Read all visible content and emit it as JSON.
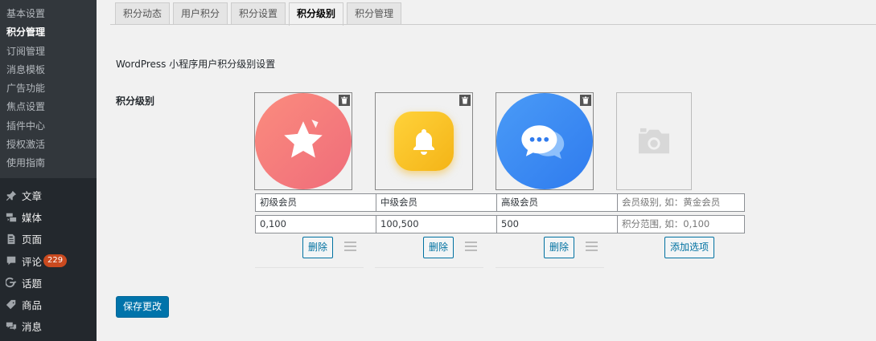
{
  "sidebar": {
    "submenu": [
      {
        "label": "基本设置"
      },
      {
        "label": "积分管理",
        "active": true
      },
      {
        "label": "订阅管理"
      },
      {
        "label": "消息模板"
      },
      {
        "label": "广告功能"
      },
      {
        "label": "焦点设置"
      },
      {
        "label": "插件中心"
      },
      {
        "label": "授权激活"
      },
      {
        "label": "使用指南"
      }
    ],
    "menu": [
      {
        "label": "文章",
        "icon": "pin-icon"
      },
      {
        "label": "媒体",
        "icon": "media-icon"
      },
      {
        "label": "页面",
        "icon": "page-icon"
      },
      {
        "label": "评论",
        "icon": "comment-icon",
        "badge": "229"
      },
      {
        "label": "话题",
        "icon": "topic-icon"
      },
      {
        "label": "商品",
        "icon": "tag-icon"
      },
      {
        "label": "消息",
        "icon": "message-icon"
      }
    ]
  },
  "tabs": [
    {
      "label": "积分动态"
    },
    {
      "label": "用户积分"
    },
    {
      "label": "积分设置"
    },
    {
      "label": "积分级别",
      "active": true
    },
    {
      "label": "积分管理"
    }
  ],
  "page": {
    "heading": "WordPress 小程序用户积分级别设置",
    "field_label": "积分级别"
  },
  "levels": [
    {
      "name": "初级会员",
      "range": "0,100",
      "delete_label": "删除",
      "icon": "star-icon",
      "color": "#f47a7a"
    },
    {
      "name": "中级会员",
      "range": "100,500",
      "delete_label": "删除",
      "icon": "bell-icon",
      "color": "#f7c01f"
    },
    {
      "name": "高级会员",
      "range": "500",
      "delete_label": "删除",
      "icon": "chat-icon",
      "color": "#3f8cf5"
    }
  ],
  "new_level": {
    "name_placeholder": "会员级别, 如：黄金会员",
    "range_placeholder": "积分范围, 如：0,100",
    "add_label": "添加选项",
    "icon": "camera-icon"
  },
  "save_label": "保存更改"
}
